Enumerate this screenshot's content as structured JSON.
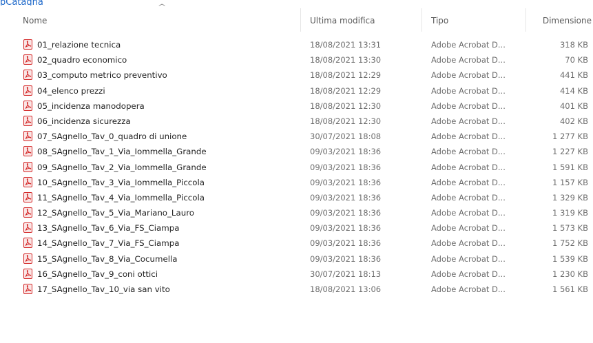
{
  "top_link": "pCatagna",
  "columns": {
    "name": "Nome",
    "modified": "Ultima modifica",
    "type": "Tipo",
    "size": "Dimensione"
  },
  "sort": {
    "column": "name",
    "direction": "ascending",
    "icon": "caret-up-icon"
  },
  "file_icon": {
    "name": "pdf-file-icon",
    "color": "#d42a2a"
  },
  "files": [
    {
      "name": "01_relazione tecnica",
      "modified": "18/08/2021 13:31",
      "type": "Adobe Acrobat D...",
      "size": "318 KB"
    },
    {
      "name": "02_quadro economico",
      "modified": "18/08/2021 13:30",
      "type": "Adobe Acrobat D...",
      "size": "70 KB"
    },
    {
      "name": "03_computo metrico preventivo",
      "modified": "18/08/2021 12:29",
      "type": "Adobe Acrobat D...",
      "size": "441 KB"
    },
    {
      "name": "04_elenco prezzi",
      "modified": "18/08/2021 12:29",
      "type": "Adobe Acrobat D...",
      "size": "414 KB"
    },
    {
      "name": "05_incidenza manodopera",
      "modified": "18/08/2021 12:30",
      "type": "Adobe Acrobat D...",
      "size": "401 KB"
    },
    {
      "name": "06_incidenza sicurezza",
      "modified": "18/08/2021 12:30",
      "type": "Adobe Acrobat D...",
      "size": "402 KB"
    },
    {
      "name": "07_SAgnello_Tav_0_quadro di unione",
      "modified": "30/07/2021 18:08",
      "type": "Adobe Acrobat D...",
      "size": "1 277 KB"
    },
    {
      "name": "08_SAgnello_Tav_1_Via_Iommella_Grande",
      "modified": "09/03/2021 18:36",
      "type": "Adobe Acrobat D...",
      "size": "1 227 KB"
    },
    {
      "name": "09_SAgnello_Tav_2_Via_Iommella_Grande",
      "modified": "09/03/2021 18:36",
      "type": "Adobe Acrobat D...",
      "size": "1 591 KB"
    },
    {
      "name": "10_SAgnello_Tav_3_Via_Iommella_Piccola",
      "modified": "09/03/2021 18:36",
      "type": "Adobe Acrobat D...",
      "size": "1 157 KB"
    },
    {
      "name": "11_SAgnello_Tav_4_Via_Iommella_Piccola",
      "modified": "09/03/2021 18:36",
      "type": "Adobe Acrobat D...",
      "size": "1 329 KB"
    },
    {
      "name": "12_SAgnello_Tav_5_Via_Mariano_Lauro",
      "modified": "09/03/2021 18:36",
      "type": "Adobe Acrobat D...",
      "size": "1 319 KB"
    },
    {
      "name": "13_SAgnello_Tav_6_Via_FS_Ciampa",
      "modified": "09/03/2021 18:36",
      "type": "Adobe Acrobat D...",
      "size": "1 573 KB"
    },
    {
      "name": "14_SAgnello_Tav_7_Via_FS_Ciampa",
      "modified": "09/03/2021 18:36",
      "type": "Adobe Acrobat D...",
      "size": "1 752 KB"
    },
    {
      "name": "15_SAgnello_Tav_8_Via_Cocumella",
      "modified": "09/03/2021 18:36",
      "type": "Adobe Acrobat D...",
      "size": "1 539 KB"
    },
    {
      "name": "16_SAgnello_Tav_9_coni ottici",
      "modified": "30/07/2021 18:13",
      "type": "Adobe Acrobat D...",
      "size": "1 230 KB"
    },
    {
      "name": "17_SAgnello_Tav_10_via san vito",
      "modified": "18/08/2021 13:06",
      "type": "Adobe Acrobat D...",
      "size": "1 561 KB"
    }
  ]
}
